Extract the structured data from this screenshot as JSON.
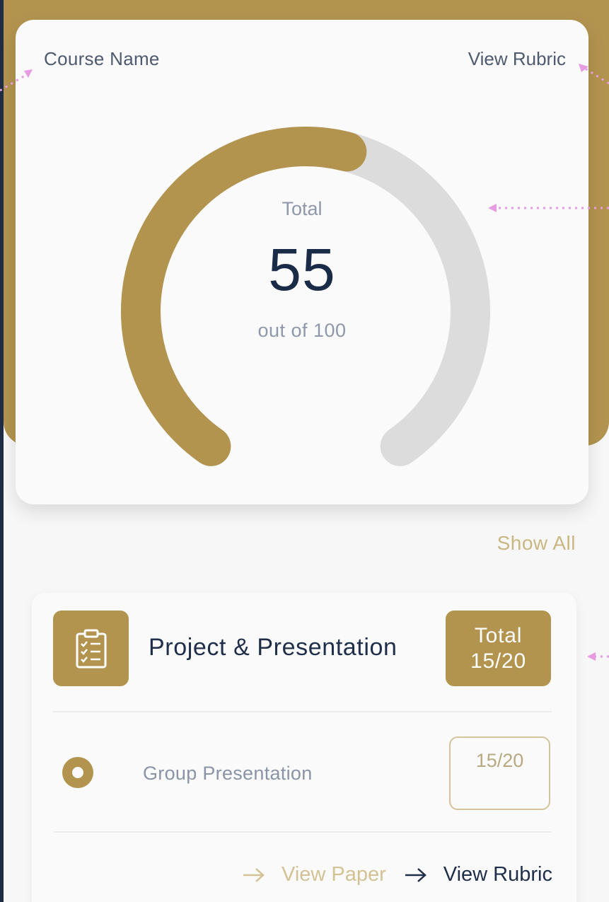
{
  "card": {
    "course_name": "Course Name",
    "view_rubric": "View Rubric"
  },
  "gauge": {
    "label": "Total",
    "value": "55",
    "out_of_label": "out of 100",
    "fraction": 0.55
  },
  "show_all": "Show All",
  "section": {
    "title": "Project & Presentation",
    "total_label": "Total",
    "total_value": "15/20",
    "icon": "clipboard-checklist-icon",
    "items": [
      {
        "label": "Group Presentation",
        "score": "15/20"
      }
    ],
    "view_paper": "View Paper",
    "view_rubric": "View Rubric"
  },
  "colors": {
    "accent": "#b3944f",
    "track": "#dcdcdc",
    "navy": "#1a2b48",
    "background": "#f7f7f7"
  }
}
